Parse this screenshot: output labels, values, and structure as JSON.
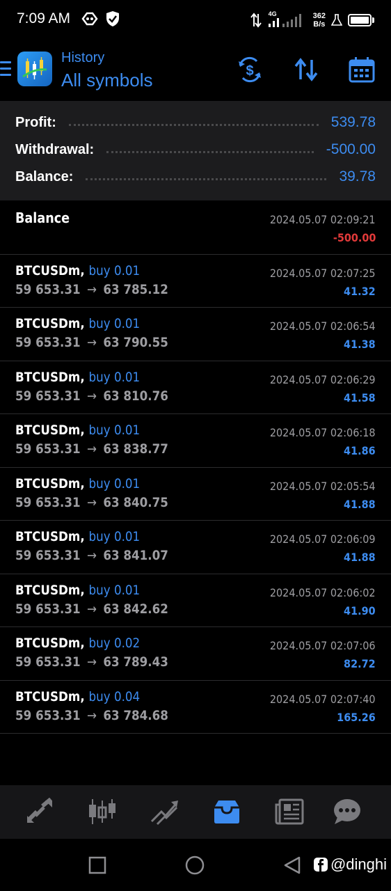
{
  "status_bar": {
    "time": "7:09 AM",
    "network_speed_value": "362",
    "network_speed_unit": "B/s",
    "network_type": "4G",
    "icons": [
      "ghost-app-icon",
      "shield-check-icon",
      "data-transfer-icon",
      "signal-icon",
      "lab-flask-icon",
      "battery-icon"
    ]
  },
  "app_bar": {
    "subtitle": "History",
    "title": "All symbols",
    "actions": [
      "dollar-refresh-icon",
      "sort-icon",
      "calendar-icon"
    ]
  },
  "summary": {
    "profit_label": "Profit:",
    "profit_value": "539.78",
    "withdrawal_label": "Withdrawal:",
    "withdrawal_value": "-500.00",
    "balance_label": "Balance:",
    "balance_value": "39.78"
  },
  "history": {
    "balance_entry": {
      "label": "Balance",
      "time": "2024.05.07 02:09:21",
      "amount": "-500.00"
    },
    "trades": [
      {
        "symbol": "BTCUSDm,",
        "side": "buy 0.01",
        "open": "59 653.31",
        "arrow": "→",
        "close": "63 785.12",
        "time": "2024.05.07 02:07:25",
        "profit": "41.32"
      },
      {
        "symbol": "BTCUSDm,",
        "side": "buy 0.01",
        "open": "59 653.31",
        "arrow": "→",
        "close": "63 790.55",
        "time": "2024.05.07 02:06:54",
        "profit": "41.38"
      },
      {
        "symbol": "BTCUSDm,",
        "side": "buy 0.01",
        "open": "59 653.31",
        "arrow": "→",
        "close": "63 810.76",
        "time": "2024.05.07 02:06:29",
        "profit": "41.58"
      },
      {
        "symbol": "BTCUSDm,",
        "side": "buy 0.01",
        "open": "59 653.31",
        "arrow": "→",
        "close": "63 838.77",
        "time": "2024.05.07 02:06:18",
        "profit": "41.86"
      },
      {
        "symbol": "BTCUSDm,",
        "side": "buy 0.01",
        "open": "59 653.31",
        "arrow": "→",
        "close": "63 840.75",
        "time": "2024.05.07 02:05:54",
        "profit": "41.88"
      },
      {
        "symbol": "BTCUSDm,",
        "side": "buy 0.01",
        "open": "59 653.31",
        "arrow": "→",
        "close": "63 841.07",
        "time": "2024.05.07 02:06:09",
        "profit": "41.88"
      },
      {
        "symbol": "BTCUSDm,",
        "side": "buy 0.01",
        "open": "59 653.31",
        "arrow": "→",
        "close": "63 842.62",
        "time": "2024.05.07 02:06:02",
        "profit": "41.90"
      },
      {
        "symbol": "BTCUSDm,",
        "side": "buy 0.02",
        "open": "59 653.31",
        "arrow": "→",
        "close": "63 789.43",
        "time": "2024.05.07 02:07:06",
        "profit": "82.72"
      },
      {
        "symbol": "BTCUSDm,",
        "side": "buy 0.04",
        "open": "59 653.31",
        "arrow": "→",
        "close": "63 784.68",
        "time": "2024.05.07 02:07:40",
        "profit": "165.26"
      }
    ]
  },
  "tab_bar": {
    "tabs": [
      "quotes-icon",
      "chart-icon",
      "trade-icon",
      "history-icon",
      "news-icon",
      "chat-icon"
    ],
    "active": "history-icon"
  },
  "system_nav": {
    "buttons": [
      "recents-icon",
      "home-icon",
      "back-icon"
    ],
    "watermark": "@dinghi"
  },
  "colors": {
    "accent": "#3d8cf0",
    "negative": "#e23a3a",
    "muted": "#9e9ea2",
    "summary_bg": "#1c1c1e",
    "tab_bg": "#161618",
    "divider": "#2c2c2e"
  }
}
